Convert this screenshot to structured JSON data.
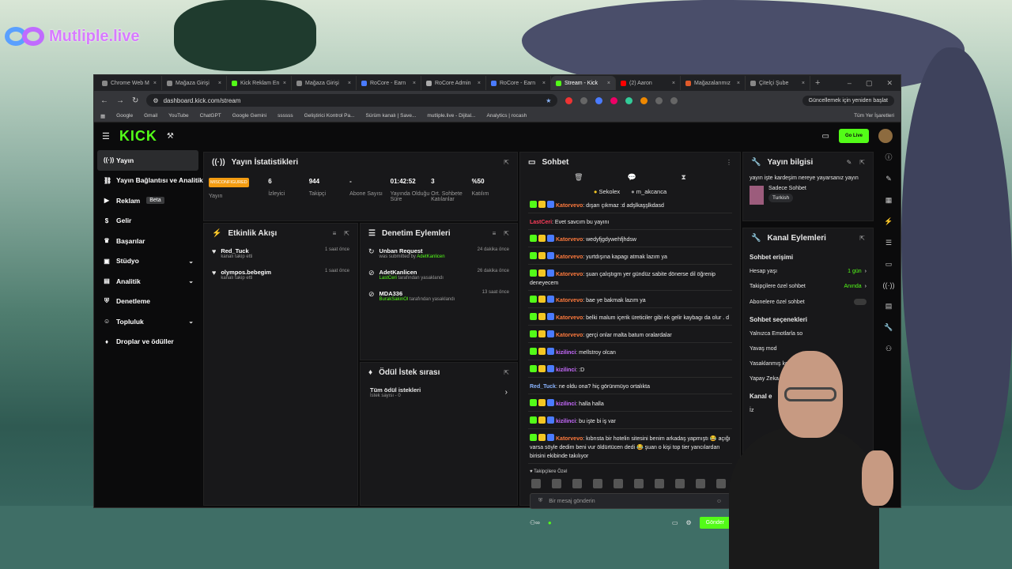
{
  "overlay": {
    "brand": "Mutliple.live"
  },
  "browser": {
    "tabs": [
      {
        "label": "Chrome Web M",
        "active": false
      },
      {
        "label": "Mağaza Girişi",
        "active": false
      },
      {
        "label": "Kick Reklam En",
        "active": false
      },
      {
        "label": "Mağaza Girişi",
        "active": false
      },
      {
        "label": "RoCore - Earn",
        "active": false
      },
      {
        "label": "RoCore Admin",
        "active": false
      },
      {
        "label": "RoCore - Earn",
        "active": false
      },
      {
        "label": "Stream - Kick",
        "active": true
      },
      {
        "label": "(2) Aaron",
        "active": false
      },
      {
        "label": "Mağazalarımız",
        "active": false
      },
      {
        "label": "Çitelçi Şube",
        "active": false
      }
    ],
    "url": "dashboard.kick.com/stream",
    "update_label": "Güncellemek için yeniden başlat",
    "bookmarks": [
      "Google",
      "Gmail",
      "YouTube",
      "ChatGPT",
      "Google Gemini",
      "ssssss",
      "Geliştirici Kontrol Pa...",
      "Sürüm kanalı | Save...",
      "mutliple.live - Dijital...",
      "Analytics | rocash"
    ],
    "all_bookmarks": "Tüm Yer İşaretleri"
  },
  "kick": {
    "logo": "KICK",
    "go_live": "Go Live",
    "sidebar": [
      {
        "label": "Yayın",
        "icon": "broadcast-icon",
        "active": true
      },
      {
        "label": "Yayın Bağlantısı ve Analitik",
        "icon": "link-icon"
      },
      {
        "label": "Reklam",
        "icon": "megaphone-icon",
        "badge": "Beta"
      },
      {
        "label": "Gelir",
        "icon": "dollar-icon"
      },
      {
        "label": "Başarılar",
        "icon": "trophy-icon"
      },
      {
        "label": "Stüdyo",
        "icon": "studio-icon",
        "chevron": true
      },
      {
        "label": "Analitik",
        "icon": "chart-icon",
        "chevron": true
      },
      {
        "label": "Denetleme",
        "icon": "shield-icon"
      },
      {
        "label": "Topluluk",
        "icon": "people-icon",
        "chevron": true
      },
      {
        "label": "Droplar ve ödüller",
        "icon": "gift-icon"
      }
    ],
    "stats": {
      "title": "Yayın İstatistikleri",
      "items": [
        {
          "value": "MISCONFIGURED",
          "label": "Yayın"
        },
        {
          "value": "6",
          "label": "İzleyici"
        },
        {
          "value": "944",
          "label": "Takipçi"
        },
        {
          "value": "-",
          "label": "Abone Sayısı"
        },
        {
          "value": "01:42:52",
          "label": "Yayında Olduğu Süre"
        },
        {
          "value": "3",
          "label": "Ort. Sohbete Katılanlar"
        },
        {
          "value": "%50",
          "label": "Katılım"
        }
      ]
    },
    "activity": {
      "title": "Etkinlik Akışı",
      "items": [
        {
          "name": "Red_Tuck",
          "sub": "kanalı takip etti",
          "time": "1 saat önce"
        },
        {
          "name": "olympos.bebegim",
          "sub": "kanalı takip etti",
          "time": "1 saat önce"
        }
      ]
    },
    "moderation": {
      "title": "Denetim Eylemleri",
      "items": [
        {
          "name": "Unban Request",
          "sub1": "was submitted by ",
          "user": "AdetKanlicen",
          "sub2": "",
          "time": "24 dakika önce"
        },
        {
          "name": "AdetKanlicen",
          "sub1": "",
          "user": "LastCeri",
          "sub2": " tarafından yasaklandı",
          "time": "26 dakika önce"
        },
        {
          "name": "MDA336",
          "sub1": "",
          "user": "BurakSakinOl",
          "sub2": " tarafından yasaklandı",
          "time": "13 saat önce"
        }
      ]
    },
    "rewards": {
      "title": "Ödül İstek sırası",
      "all": "Tüm ödül istekleri",
      "count": "İstek sayısı - 0"
    },
    "chat": {
      "title": "Sohbet",
      "mods": [
        "Sekolex",
        "m_akcanca"
      ],
      "messages": [
        {
          "user": "Katorvevo",
          "color": "#ff7a3d",
          "text": ": dışarı çıkmaz :d adşlkaşşlkdasd",
          "badges": 3
        },
        {
          "user": "LastCeri",
          "color": "#ff3d5a",
          "text": ": Evet savcım bu yayını",
          "badges": 0
        },
        {
          "user": "Katorvevo",
          "color": "#ff7a3d",
          "text": ": wedyfjgdywehfjhdsw",
          "badges": 3
        },
        {
          "user": "Katorvevo",
          "color": "#ff7a3d",
          "text": ": yurtdışına kapagı atmak lazım ya",
          "badges": 3
        },
        {
          "user": "Katorvevo",
          "color": "#ff7a3d",
          "text": ": şuan çalıştıgm yer gündüz sabite dönerse dil öğrenip deneyecem",
          "badges": 3
        },
        {
          "user": "Katorvevo",
          "color": "#ff7a3d",
          "text": ": bae ye bakmak lazım ya",
          "badges": 3
        },
        {
          "user": "Katorvevo",
          "color": "#ff7a3d",
          "text": ": belki malum içerik üreticiler gibi ek gelir kaybagı da olur . d",
          "badges": 3
        },
        {
          "user": "Katorvevo",
          "color": "#ff7a3d",
          "text": ": gerçi onlar malta batum oralardalar",
          "badges": 3
        },
        {
          "user": "kizilinci",
          "color": "#c86bff",
          "text": ": mellstroy olcan",
          "badges": 3
        },
        {
          "user": "kizilinci",
          "color": "#c86bff",
          "text": ": :D",
          "badges": 3
        },
        {
          "user": "Red_Tuck",
          "color": "#8ab4ff",
          "text": ": ne oldu ona? hiç görünmüyo ortalıkta",
          "badges": 0
        },
        {
          "user": "kizilinci",
          "color": "#c86bff",
          "text": ": halla halla",
          "badges": 3
        },
        {
          "user": "kizilinci",
          "color": "#c86bff",
          "text": ": bu işte bi iş var",
          "badges": 3
        },
        {
          "user": "Katorvevo",
          "color": "#ff7a3d",
          "text": ": kıbrısta bir hotelin sitesini benim arkadaş yapmıştı 😂 açığı varsa söyle dedim beni vur öldürtücen dedi 😂 şuan o kişi top tier yancılardan birisini ekibinde takılıyor",
          "badges": 3
        }
      ],
      "sub_only": "Takipçilere Özel",
      "placeholder": "Bir mesaj gönderin",
      "send": "Gönder"
    },
    "info": {
      "title": "Yayın bilgisi",
      "stream_title": "yayın işte kardeşim nereye yayarsanız yayın",
      "category": "Sadece Sohbet",
      "tag": "Turkish"
    },
    "actions": {
      "title": "Kanal Eylemleri",
      "chat_access": "Sohbet erişimi",
      "rows": [
        {
          "label": "Hesap yaşı",
          "value": "1 gün"
        },
        {
          "label": "Takipçilere özel sohbet",
          "value": "Anında"
        },
        {
          "label": "Abonelere özel sohbet",
          "value": ""
        }
      ],
      "chat_options": "Sohbet seçenekleri",
      "options": [
        "Yalnızca Emotlarla so",
        "Yavaş mod",
        "Yasaklanmış kelimele",
        "Yapay Zeka ile Sohbet"
      ],
      "more_section": "Kanal e",
      "more_row": "İz"
    }
  }
}
